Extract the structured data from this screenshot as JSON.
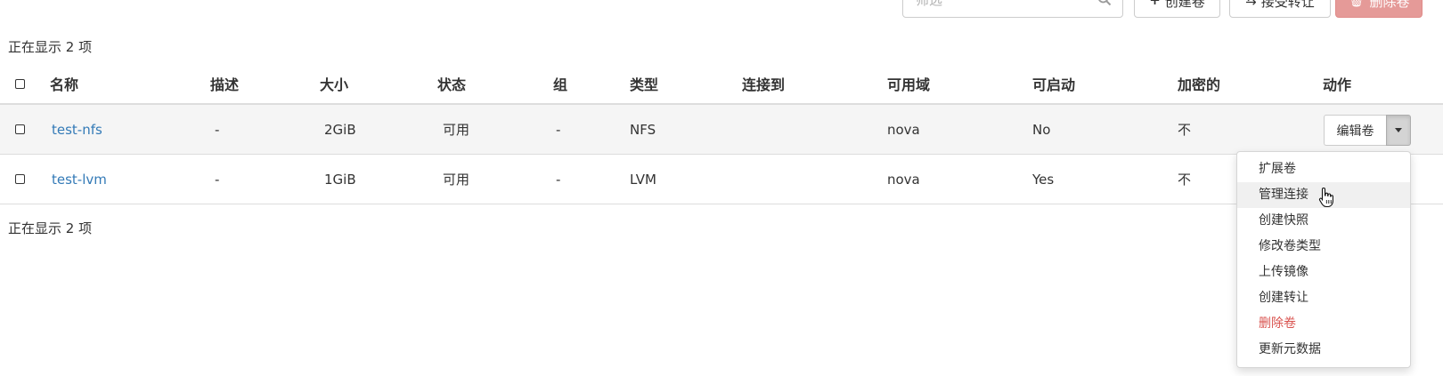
{
  "toolbar": {
    "filter_placeholder": "筛选",
    "create_label": "创建卷",
    "transfer_label": "接受转让",
    "delete_label": "删除卷"
  },
  "count_text": "正在显示 2 项",
  "table": {
    "headers": [
      "名称",
      "描述",
      "大小",
      "状态",
      "组",
      "类型",
      "连接到",
      "可用域",
      "可启动",
      "加密的",
      "动作"
    ],
    "rows": [
      {
        "name": "test-nfs",
        "desc": "-",
        "size": "2GiB",
        "status": "可用",
        "group": "-",
        "type": "NFS",
        "attached": "",
        "zone": "nova",
        "bootable": "No",
        "encrypted": "不",
        "action": "编辑卷"
      },
      {
        "name": "test-lvm",
        "desc": "-",
        "size": "1GiB",
        "status": "可用",
        "group": "-",
        "type": "LVM",
        "attached": "",
        "zone": "nova",
        "bootable": "Yes",
        "encrypted": "不",
        "action": ""
      }
    ]
  },
  "menu": {
    "items": [
      "扩展卷",
      "管理连接",
      "创建快照",
      "修改卷类型",
      "上传镜像",
      "创建转让",
      "删除卷",
      "更新元数据"
    ],
    "active_item": "管理连接",
    "danger_item": "删除卷"
  },
  "colors": {
    "link": "#337ab7",
    "danger": "#d9534f",
    "delete_button_bg": "#e59a98"
  }
}
